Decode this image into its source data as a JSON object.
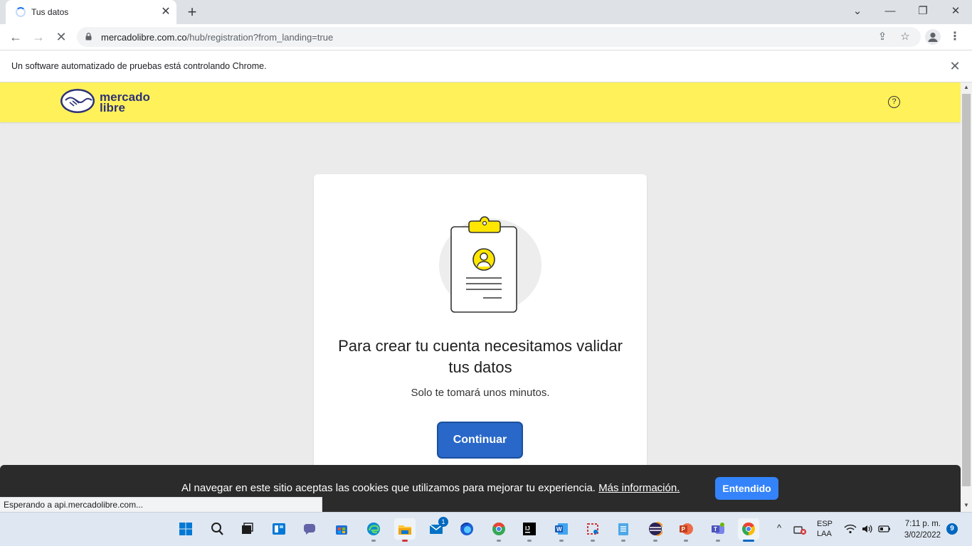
{
  "browser": {
    "tab_title": "Tus datos",
    "tab_close": "✕",
    "new_tab": "+",
    "url_host": "mercadolibre.com.co",
    "url_path": "/hub/registration?from_landing=true",
    "infobar_text": "Un software automatizado de pruebas está controlando Chrome.",
    "infobar_close": "✕",
    "status_text": "Esperando a api.mercadolibre.com..."
  },
  "header": {
    "logo_line1": "mercado",
    "logo_line2": "libre",
    "help": "?"
  },
  "card": {
    "title": "Para crear tu cuenta necesitamos validar tus datos",
    "subtitle": "Solo te tomará unos minutos.",
    "button": "Continuar"
  },
  "cookie": {
    "text": "Al navegar en este sitio aceptas las cookies que utilizamos para mejorar tu experiencia.",
    "link": "Más información.",
    "button": "Entendido"
  },
  "taskbar": {
    "mail_badge": "1",
    "lang_line1": "ESP",
    "lang_line2": "LAA",
    "time": "7:11 p. m.",
    "date": "3/02/2022",
    "notifications": "9"
  },
  "colors": {
    "header_yellow": "#fff159",
    "primary_blue": "#3483fa",
    "continue_blue": "#2968c8",
    "cookie_bg": "#2b2b2b"
  }
}
